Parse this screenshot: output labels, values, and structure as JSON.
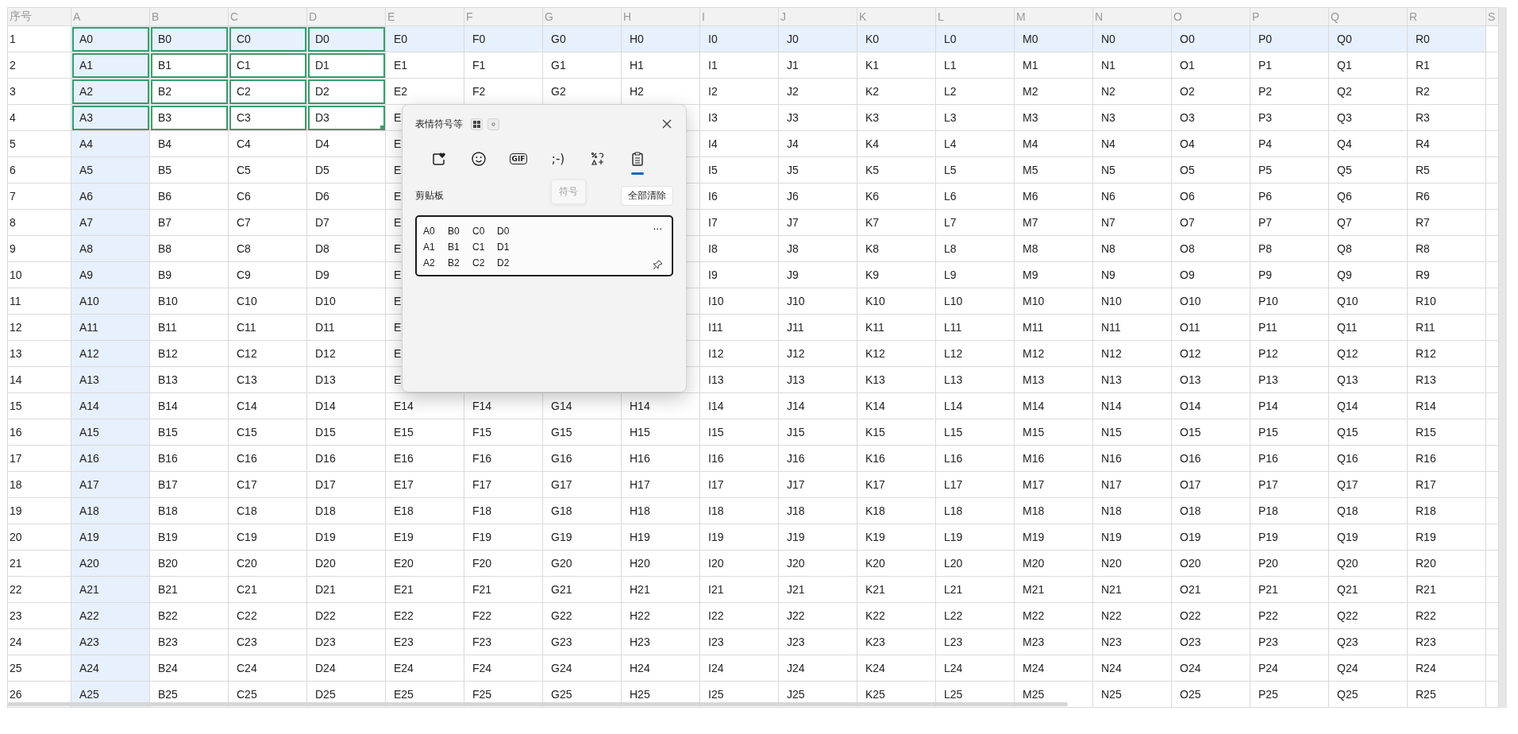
{
  "sheet": {
    "corner": "序号",
    "columns": [
      {
        "label": "A",
        "selected": true,
        "highlighted": true
      },
      {
        "label": "B",
        "selected": true,
        "highlighted": false
      },
      {
        "label": "C",
        "selected": true,
        "highlighted": false
      },
      {
        "label": "D",
        "selected": true,
        "highlighted": false
      },
      {
        "label": "E",
        "selected": false,
        "highlighted": false
      },
      {
        "label": "F",
        "selected": false,
        "highlighted": false
      },
      {
        "label": "G",
        "selected": false,
        "highlighted": false
      },
      {
        "label": "H",
        "selected": false,
        "highlighted": false
      },
      {
        "label": "I",
        "selected": false,
        "highlighted": false
      },
      {
        "label": "J",
        "selected": false,
        "highlighted": false
      },
      {
        "label": "K",
        "selected": false,
        "highlighted": false
      },
      {
        "label": "L",
        "selected": false,
        "highlighted": false
      },
      {
        "label": "M",
        "selected": false,
        "highlighted": false
      },
      {
        "label": "N",
        "selected": false,
        "highlighted": false
      },
      {
        "label": "O",
        "selected": false,
        "highlighted": false
      },
      {
        "label": "P",
        "selected": false,
        "highlighted": false
      },
      {
        "label": "Q",
        "selected": false,
        "highlighted": false
      },
      {
        "label": "R",
        "selected": false,
        "highlighted": false
      },
      {
        "label": "S",
        "selected": false,
        "highlighted": false
      }
    ],
    "rows": [
      {
        "number": "1",
        "selected": true,
        "highlighted": true,
        "cells": [
          "A0",
          "B0",
          "C0",
          "D0",
          "E0",
          "F0",
          "G0",
          "H0",
          "I0",
          "J0",
          "K0",
          "L0",
          "M0",
          "N0",
          "O0",
          "P0",
          "Q0",
          "R0"
        ]
      },
      {
        "number": "2",
        "selected": true,
        "highlighted": false,
        "cells": [
          "A1",
          "B1",
          "C1",
          "D1",
          "E1",
          "F1",
          "G1",
          "H1",
          "I1",
          "J1",
          "K1",
          "L1",
          "M1",
          "N1",
          "O1",
          "P1",
          "Q1",
          "R1"
        ]
      },
      {
        "number": "3",
        "selected": true,
        "highlighted": false,
        "cells": [
          "A2",
          "B2",
          "C2",
          "D2",
          "E2",
          "F2",
          "G2",
          "H2",
          "I2",
          "J2",
          "K2",
          "L2",
          "M2",
          "N2",
          "O2",
          "P2",
          "Q2",
          "R2"
        ]
      },
      {
        "number": "4",
        "selected": true,
        "highlighted": false,
        "cells": [
          "A3",
          "B3",
          "C3",
          "D3",
          "E",
          null,
          null,
          null,
          "I3",
          "J3",
          "K3",
          "L3",
          "M3",
          "N3",
          "O3",
          "P3",
          "Q3",
          "R3"
        ]
      },
      {
        "number": "5",
        "selected": false,
        "highlighted": false,
        "cells": [
          "A4",
          "B4",
          "C4",
          "D4",
          "E",
          null,
          null,
          null,
          "I4",
          "J4",
          "K4",
          "L4",
          "M4",
          "N4",
          "O4",
          "P4",
          "Q4",
          "R4"
        ]
      },
      {
        "number": "6",
        "selected": false,
        "highlighted": false,
        "cells": [
          "A5",
          "B5",
          "C5",
          "D5",
          "E",
          null,
          null,
          null,
          "I5",
          "J5",
          "K5",
          "L5",
          "M5",
          "N5",
          "O5",
          "P5",
          "Q5",
          "R5"
        ]
      },
      {
        "number": "7",
        "selected": false,
        "highlighted": false,
        "cells": [
          "A6",
          "B6",
          "C6",
          "D6",
          "E",
          null,
          null,
          null,
          "I6",
          "J6",
          "K6",
          "L6",
          "M6",
          "N6",
          "O6",
          "P6",
          "Q6",
          "R6"
        ]
      },
      {
        "number": "8",
        "selected": false,
        "highlighted": false,
        "cells": [
          "A7",
          "B7",
          "C7",
          "D7",
          "E",
          null,
          null,
          null,
          "I7",
          "J7",
          "K7",
          "L7",
          "M7",
          "N7",
          "O7",
          "P7",
          "Q7",
          "R7"
        ]
      },
      {
        "number": "9",
        "selected": false,
        "highlighted": false,
        "cells": [
          "A8",
          "B8",
          "C8",
          "D8",
          "E",
          null,
          null,
          null,
          "I8",
          "J8",
          "K8",
          "L8",
          "M8",
          "N8",
          "O8",
          "P8",
          "Q8",
          "R8"
        ]
      },
      {
        "number": "10",
        "selected": false,
        "highlighted": false,
        "cells": [
          "A9",
          "B9",
          "C9",
          "D9",
          "E",
          null,
          null,
          null,
          "I9",
          "J9",
          "K9",
          "L9",
          "M9",
          "N9",
          "O9",
          "P9",
          "Q9",
          "R9"
        ]
      },
      {
        "number": "11",
        "selected": false,
        "highlighted": false,
        "cells": [
          "A10",
          "B10",
          "C10",
          "D10",
          "E",
          null,
          null,
          null,
          "I10",
          "J10",
          "K10",
          "L10",
          "M10",
          "N10",
          "O10",
          "P10",
          "Q10",
          "R10"
        ]
      },
      {
        "number": "12",
        "selected": false,
        "highlighted": false,
        "cells": [
          "A11",
          "B11",
          "C11",
          "D11",
          "E",
          null,
          null,
          null,
          "I11",
          "J11",
          "K11",
          "L11",
          "M11",
          "N11",
          "O11",
          "P11",
          "Q11",
          "R11"
        ]
      },
      {
        "number": "13",
        "selected": false,
        "highlighted": false,
        "cells": [
          "A12",
          "B12",
          "C12",
          "D12",
          "E",
          null,
          null,
          null,
          "I12",
          "J12",
          "K12",
          "L12",
          "M12",
          "N12",
          "O12",
          "P12",
          "Q12",
          "R12"
        ]
      },
      {
        "number": "14",
        "selected": false,
        "highlighted": false,
        "cells": [
          "A13",
          "B13",
          "C13",
          "D13",
          "E",
          null,
          null,
          null,
          "I13",
          "J13",
          "K13",
          "L13",
          "M13",
          "N13",
          "O13",
          "P13",
          "Q13",
          "R13"
        ]
      },
      {
        "number": "15",
        "selected": false,
        "highlighted": false,
        "cells": [
          "A14",
          "B14",
          "C14",
          "D14",
          "E14",
          "F14",
          "G14",
          "H14",
          "I14",
          "J14",
          "K14",
          "L14",
          "M14",
          "N14",
          "O14",
          "P14",
          "Q14",
          "R14"
        ]
      },
      {
        "number": "16",
        "selected": false,
        "highlighted": false,
        "cells": [
          "A15",
          "B15",
          "C15",
          "D15",
          "E15",
          "F15",
          "G15",
          "H15",
          "I15",
          "J15",
          "K15",
          "L15",
          "M15",
          "N15",
          "O15",
          "P15",
          "Q15",
          "R15"
        ]
      },
      {
        "number": "17",
        "selected": false,
        "highlighted": false,
        "cells": [
          "A16",
          "B16",
          "C16",
          "D16",
          "E16",
          "F16",
          "G16",
          "H16",
          "I16",
          "J16",
          "K16",
          "L16",
          "M16",
          "N16",
          "O16",
          "P16",
          "Q16",
          "R16"
        ]
      },
      {
        "number": "18",
        "selected": false,
        "highlighted": false,
        "cells": [
          "A17",
          "B17",
          "C17",
          "D17",
          "E17",
          "F17",
          "G17",
          "H17",
          "I17",
          "J17",
          "K17",
          "L17",
          "M17",
          "N17",
          "O17",
          "P17",
          "Q17",
          "R17"
        ]
      },
      {
        "number": "19",
        "selected": false,
        "highlighted": false,
        "cells": [
          "A18",
          "B18",
          "C18",
          "D18",
          "E18",
          "F18",
          "G18",
          "H18",
          "I18",
          "J18",
          "K18",
          "L18",
          "M18",
          "N18",
          "O18",
          "P18",
          "Q18",
          "R18"
        ]
      },
      {
        "number": "20",
        "selected": false,
        "highlighted": false,
        "cells": [
          "A19",
          "B19",
          "C19",
          "D19",
          "E19",
          "F19",
          "G19",
          "H19",
          "I19",
          "J19",
          "K19",
          "L19",
          "M19",
          "N19",
          "O19",
          "P19",
          "Q19",
          "R19"
        ]
      },
      {
        "number": "21",
        "selected": false,
        "highlighted": false,
        "cells": [
          "A20",
          "B20",
          "C20",
          "D20",
          "E20",
          "F20",
          "G20",
          "H20",
          "I20",
          "J20",
          "K20",
          "L20",
          "M20",
          "N20",
          "O20",
          "P20",
          "Q20",
          "R20"
        ]
      },
      {
        "number": "22",
        "selected": false,
        "highlighted": false,
        "cells": [
          "A21",
          "B21",
          "C21",
          "D21",
          "E21",
          "F21",
          "G21",
          "H21",
          "I21",
          "J21",
          "K21",
          "L21",
          "M21",
          "N21",
          "O21",
          "P21",
          "Q21",
          "R21"
        ]
      },
      {
        "number": "23",
        "selected": false,
        "highlighted": false,
        "cells": [
          "A22",
          "B22",
          "C22",
          "D22",
          "E22",
          "F22",
          "G22",
          "H22",
          "I22",
          "J22",
          "K22",
          "L22",
          "M22",
          "N22",
          "O22",
          "P22",
          "Q22",
          "R22"
        ]
      },
      {
        "number": "24",
        "selected": false,
        "highlighted": false,
        "cells": [
          "A23",
          "B23",
          "C23",
          "D23",
          "E23",
          "F23",
          "G23",
          "H23",
          "I23",
          "J23",
          "K23",
          "L23",
          "M23",
          "N23",
          "O23",
          "P23",
          "Q23",
          "R23"
        ]
      },
      {
        "number": "25",
        "selected": false,
        "highlighted": false,
        "cells": [
          "A24",
          "B24",
          "C24",
          "D24",
          "E24",
          "F24",
          "G24",
          "H24",
          "I24",
          "J24",
          "K24",
          "L24",
          "M24",
          "N24",
          "O24",
          "P24",
          "Q24",
          "R24"
        ]
      },
      {
        "number": "26",
        "selected": false,
        "highlighted": false,
        "cells": [
          "A25",
          "B25",
          "C25",
          "D25",
          "E25",
          "F25",
          "G25",
          "H25",
          "I25",
          "J25",
          "K25",
          "L25",
          "M25",
          "N25",
          "O25",
          "P25",
          "Q25",
          "R25"
        ]
      }
    ]
  },
  "popup": {
    "title": "表情符号等",
    "tabs": [
      {
        "kind": "sticker",
        "selected": false
      },
      {
        "kind": "emoji",
        "selected": false
      },
      {
        "kind": "gif",
        "label": "GIF",
        "selected": false
      },
      {
        "kind": "kaomoji",
        "label": ";-)",
        "selected": false
      },
      {
        "kind": "symbols",
        "selected": false
      },
      {
        "kind": "clipboard",
        "selected": true
      }
    ],
    "tooltip": "符号",
    "section_title": "剪贴板",
    "clear_button": "全部清除",
    "clips": [
      {
        "lines": [
          "A0\tB0\tC0\tD0",
          "A1\tB1\tC1\tD1",
          "A2\tB2\tC2\tD2"
        ],
        "more": "···",
        "pinned": false
      }
    ]
  }
}
